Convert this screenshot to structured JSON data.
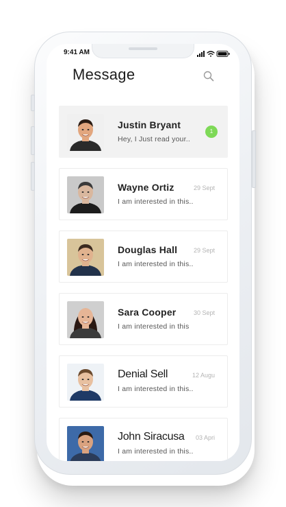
{
  "status_bar": {
    "time": "9:41 AM"
  },
  "header": {
    "title": "Message"
  },
  "conversations": [
    {
      "name": "Justin Bryant",
      "preview": "Hey, I Just read your..",
      "date": "",
      "unread": "1",
      "active": true,
      "skin": "#e2a67e",
      "hair": "#2b1c14",
      "shirt": "#2a2a2a",
      "bg": "#f0f0f0"
    },
    {
      "name": "Wayne Ortiz",
      "preview": "I am interested in this..",
      "date": "29 Sept",
      "unread": "",
      "active": false,
      "skin": "#d9b79e",
      "hair": "#3a3a3a",
      "shirt": "#1d1d1d",
      "bg": "#c9c9c9"
    },
    {
      "name": "Douglas Hall",
      "preview": "I am interested in this..",
      "date": "29 Sept",
      "unread": "",
      "active": false,
      "skin": "#e0b28e",
      "hair": "#3b2a1f",
      "shirt": "#22324a",
      "bg": "#d8c49a"
    },
    {
      "name": "Sara Cooper",
      "preview": "I am interested in this",
      "date": "30 Sept",
      "unread": "",
      "active": false,
      "skin": "#e6b596",
      "hair": "#2a1812",
      "shirt": "#3b3b3b",
      "bg": "#cfcfcf"
    },
    {
      "name": "Denial Sell",
      "preview": "I am interested in this..",
      "date": "12 Augu",
      "unread": "",
      "active": false,
      "skin": "#e8c0a0",
      "hair": "#6b4a2e",
      "shirt": "#1f3a66",
      "bg": "#eef2f6"
    },
    {
      "name": "John Siracusa",
      "preview": "I am interested in this..",
      "date": "03 Apri",
      "unread": "",
      "active": false,
      "skin": "#d9a27f",
      "hair": "#2a1a12",
      "shirt": "#2b3c5a",
      "bg": "#3d6aa8"
    }
  ]
}
